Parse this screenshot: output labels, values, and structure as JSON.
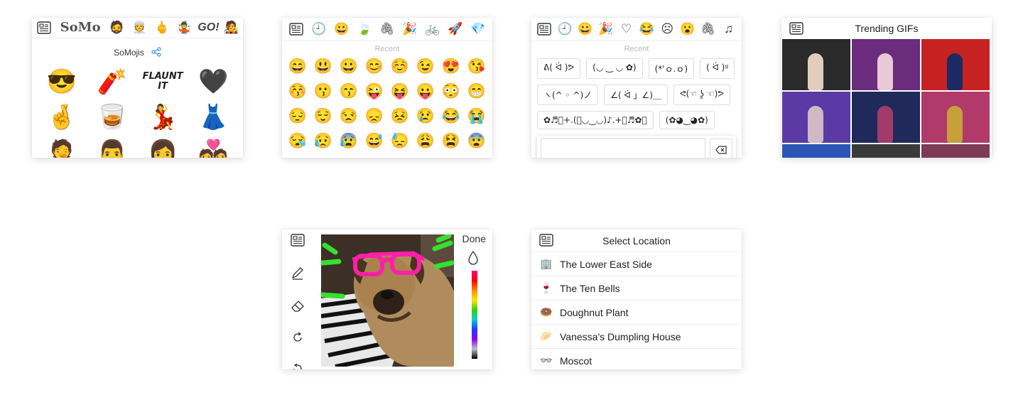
{
  "somo": {
    "tabs": [
      {
        "kind": "keyboard-icon",
        "text": ""
      },
      {
        "kind": "text",
        "text": "SoMo"
      },
      {
        "kind": "emoji",
        "text": "🧔"
      },
      {
        "kind": "emoji",
        "text": "👳"
      },
      {
        "kind": "emoji",
        "text": "🖕"
      },
      {
        "kind": "emoji",
        "text": "🤹"
      },
      {
        "kind": "text",
        "text": "GO!"
      },
      {
        "kind": "emoji",
        "text": "🧑‍🎤"
      }
    ],
    "header_label": "SoMojis",
    "share_icon": "share-icon",
    "stickers": [
      {
        "name": "sunglasses-man-sticker",
        "text": "😎"
      },
      {
        "name": "lighter-sticker",
        "text": "🧨"
      },
      {
        "name": "flaunt-it-sticker",
        "text": "FLAUNT IT"
      },
      {
        "name": "black-heart-sticker",
        "text": "🖤"
      },
      {
        "name": "crossed-fingers-sticker",
        "text": "🤞"
      },
      {
        "name": "shot-glass-sticker",
        "text": "🥃"
      },
      {
        "name": "dancer-sticker",
        "text": "💃"
      },
      {
        "name": "black-dress-sticker",
        "text": "👗"
      },
      {
        "name": "facepalm-sticker",
        "text": "🤦"
      },
      {
        "name": "man-face-sticker",
        "text": "👨"
      },
      {
        "name": "woman-sticker",
        "text": "👩"
      },
      {
        "name": "couple-sticker",
        "text": "💑"
      }
    ]
  },
  "emoji": {
    "tabs": [
      "⌨",
      "🕘",
      "😀",
      "🍃",
      "🖇",
      "🎉",
      "🚲",
      "🚀",
      "💎"
    ],
    "section_label": "Recent",
    "rows": [
      [
        "😄",
        "😃",
        "😀",
        "😊",
        "☺️",
        "😉",
        "😍",
        "😘"
      ],
      [
        "😚",
        "😗",
        "😙",
        "😜",
        "😝",
        "😛",
        "😳",
        "😁"
      ],
      [
        "😔",
        "😌",
        "😒",
        "😞",
        "😣",
        "😢",
        "😂",
        "😭"
      ],
      [
        "😪",
        "😥",
        "😰",
        "😅",
        "😓",
        "😩",
        "😫",
        "😨"
      ]
    ]
  },
  "kaomoji": {
    "tabs": [
      "⌨",
      "🕘",
      "😀",
      "🎉",
      "♡",
      "😂",
      "☹",
      "😮",
      "🖇",
      "♫"
    ],
    "section_label": "Recent",
    "items": [
      "ᕕ( ᐛ )ᕗ",
      "(◡ ‿ ◡ ✿)",
      "(*'ｏ.ｏ)",
      "( ᐛ )ᵍ",
      "ヽ(^ ◦ ^)ノ",
      "∠( ᐛ 」∠)＿",
      "ᕙ(☜ ʖ̯ ☜)ᕗ",
      "✿♬ﾟ+.(｡◡‿◡)♪.+ﾟ♬✿｡",
      "(✿◕‿◕✿)"
    ],
    "input_value": "",
    "delete_icon": "backspace-icon"
  },
  "gifs": {
    "title": "Trending GIFs",
    "tiles": [
      {
        "bg": "#2a2a2a",
        "fig": "#e2cdbd"
      },
      {
        "bg": "#6b2c7d",
        "fig": "#e8c9d8"
      },
      {
        "bg": "#c62222",
        "fig": "#1b2a63"
      },
      {
        "bg": "#5b3aa5",
        "fig": "#d0b8c5"
      },
      {
        "bg": "#1f2a5a",
        "fig": "#a13c6a"
      },
      {
        "bg": "#b23a6a",
        "fig": "#c7a03a"
      },
      {
        "bg": "#2b56b6",
        "fig": "#444444"
      },
      {
        "bg": "#3a3a3a",
        "fig": "#777777"
      },
      {
        "bg": "#7d3b55",
        "fig": "#cc9999"
      }
    ]
  },
  "draw": {
    "done_label": "Done",
    "tools": [
      "keyboard-icon",
      "pencil-icon",
      "eraser-icon",
      "redo-icon",
      "undo-icon"
    ]
  },
  "location": {
    "title": "Select Location",
    "items": [
      {
        "icon": "🏢",
        "label": "The Lower East Side"
      },
      {
        "icon": "🍷",
        "label": "The Ten Bells"
      },
      {
        "icon": "🍩",
        "label": "Doughnut Plant"
      },
      {
        "icon": "🥟",
        "label": "Vanessa's Dumpling House"
      },
      {
        "icon": "👓",
        "label": "Moscot"
      }
    ]
  }
}
